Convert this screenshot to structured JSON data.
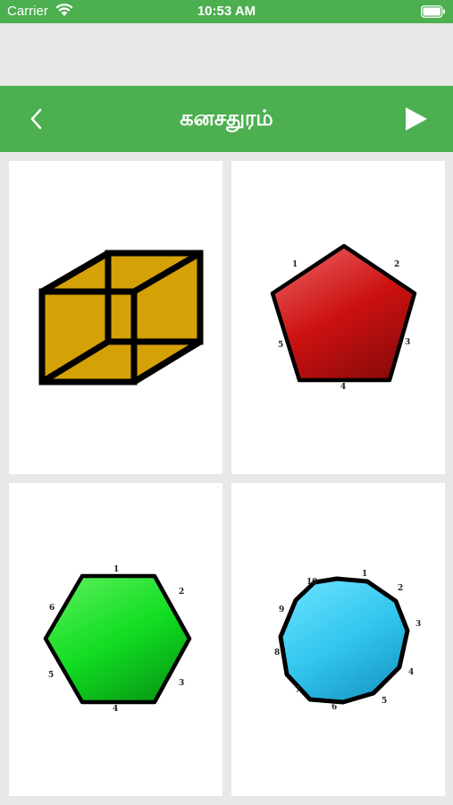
{
  "status": {
    "carrier": "Carrier",
    "time": "10:53 AM",
    "icons": [
      "wifi-icon",
      "battery-icon"
    ]
  },
  "nav": {
    "title": "கனசதுரம்",
    "back_icon": "chevron-left-icon",
    "play_icon": "play-icon"
  },
  "colors": {
    "header": "#4caf50",
    "background": "#e8e8e8",
    "card": "#ffffff",
    "cube": "#d4a106",
    "pentagon": "#cc1111",
    "hexagon": "#11cc22",
    "decagon": "#33c6ee"
  },
  "cards": [
    {
      "shape": "cube",
      "labels": []
    },
    {
      "shape": "pentagon",
      "labels": [
        "1",
        "2",
        "3",
        "4",
        "5"
      ]
    },
    {
      "shape": "hexagon",
      "labels": [
        "1",
        "2",
        "3",
        "4",
        "5",
        "6"
      ]
    },
    {
      "shape": "decagon",
      "labels": [
        "1",
        "2",
        "3",
        "4",
        "5",
        "6",
        "7",
        "8",
        "9",
        "10"
      ]
    }
  ]
}
